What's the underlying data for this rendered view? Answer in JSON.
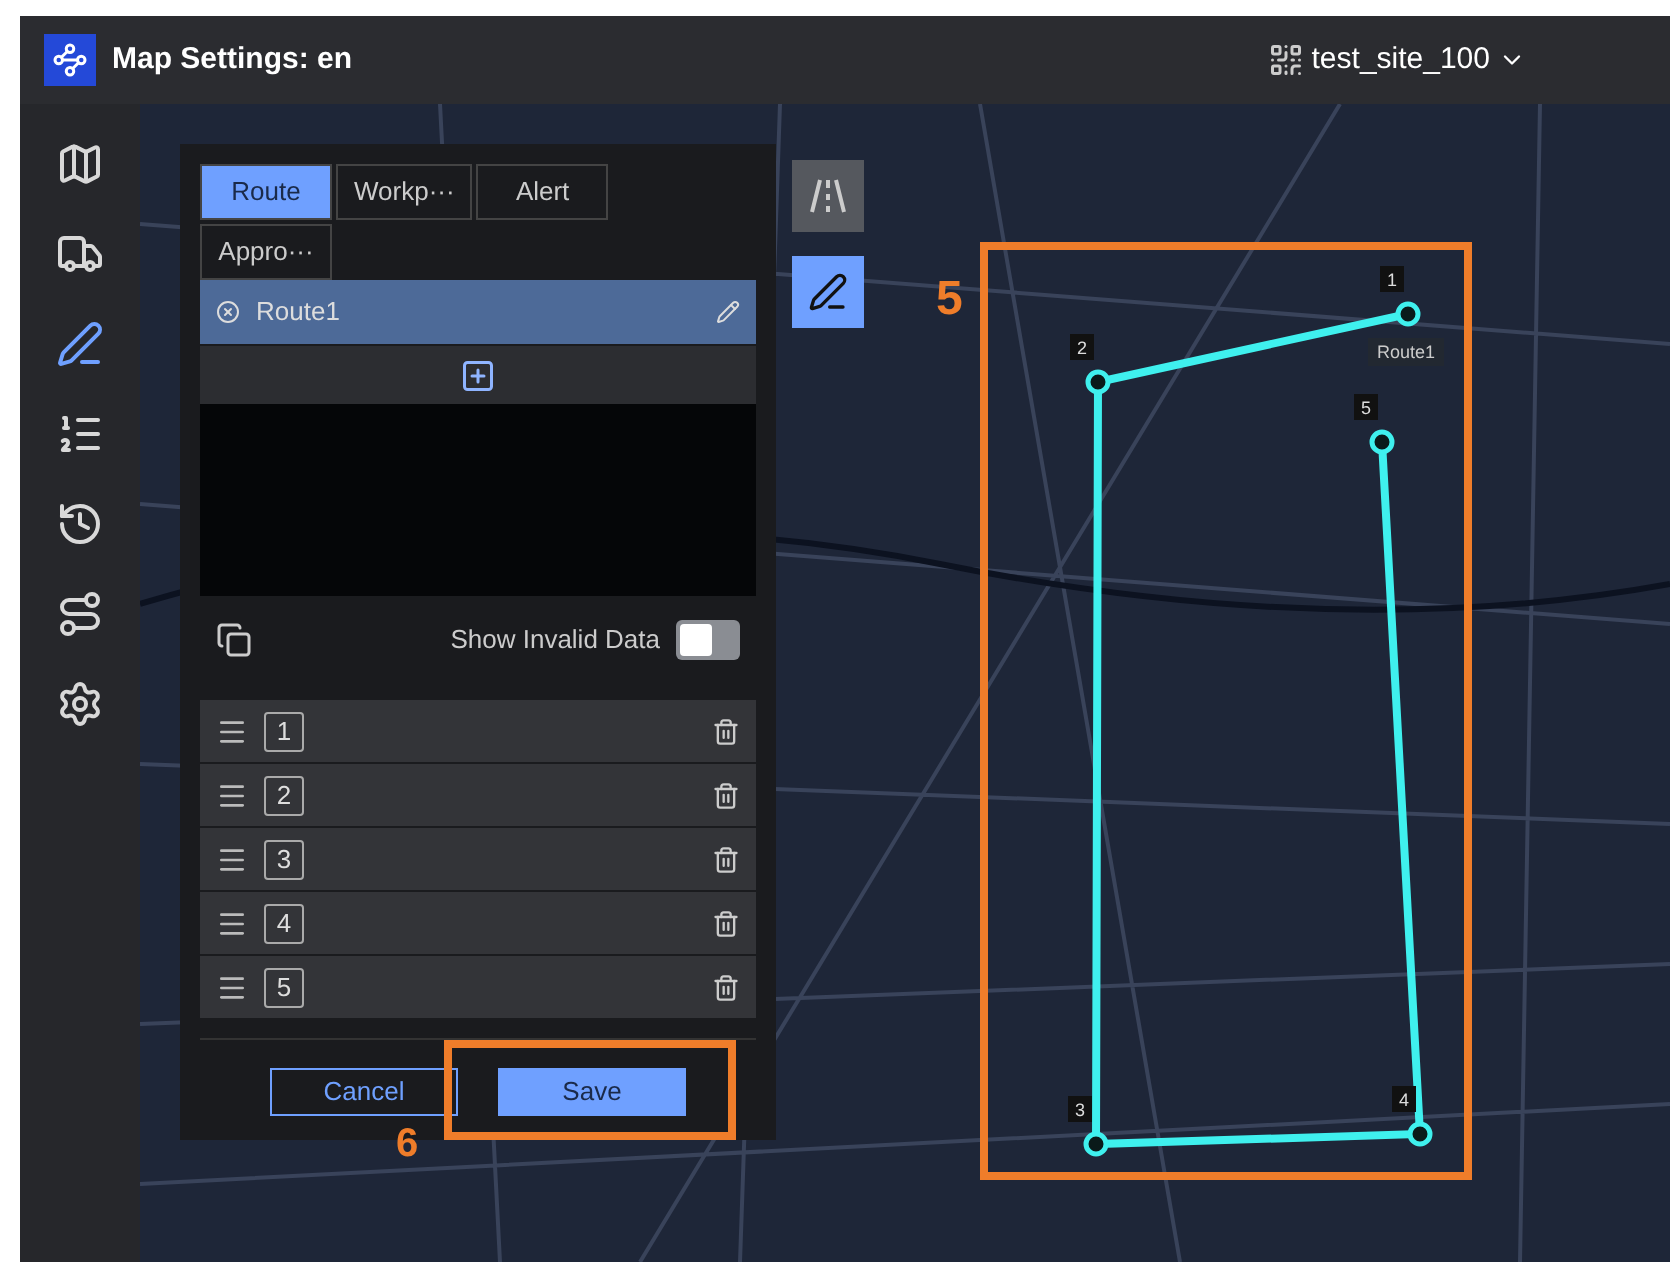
{
  "header": {
    "title": "Map Settings: en",
    "site": "test_site_100"
  },
  "sidebar": {
    "items": [
      {
        "selected": false
      },
      {
        "selected": false
      },
      {
        "selected": true
      },
      {
        "selected": false
      },
      {
        "selected": false
      },
      {
        "selected": false
      },
      {
        "selected": false
      }
    ]
  },
  "panel": {
    "tabs": [
      {
        "label": "Route",
        "selected": true
      },
      {
        "label": "Workp···",
        "selected": false
      },
      {
        "label": "Alert",
        "selected": false
      },
      {
        "label": "Appro···",
        "selected": false
      }
    ],
    "routes": [
      {
        "name": "Route1",
        "selected": true
      }
    ],
    "show_invalid": {
      "label": "Show Invalid Data",
      "on": false
    },
    "waypoints": [
      {
        "label": "1"
      },
      {
        "label": "2"
      },
      {
        "label": "3"
      },
      {
        "label": "4"
      },
      {
        "label": "5"
      }
    ],
    "cancel": "Cancel",
    "save": "Save"
  },
  "tools": [
    {
      "selected": false
    },
    {
      "selected": true
    }
  ],
  "map": {
    "route_label": "Route1",
    "points": [
      {
        "label": "1"
      },
      {
        "label": "2"
      },
      {
        "label": "3"
      },
      {
        "label": "4"
      },
      {
        "label": "5"
      }
    ]
  },
  "annotations": [
    {
      "label": "5"
    },
    {
      "label": "6"
    }
  ]
}
